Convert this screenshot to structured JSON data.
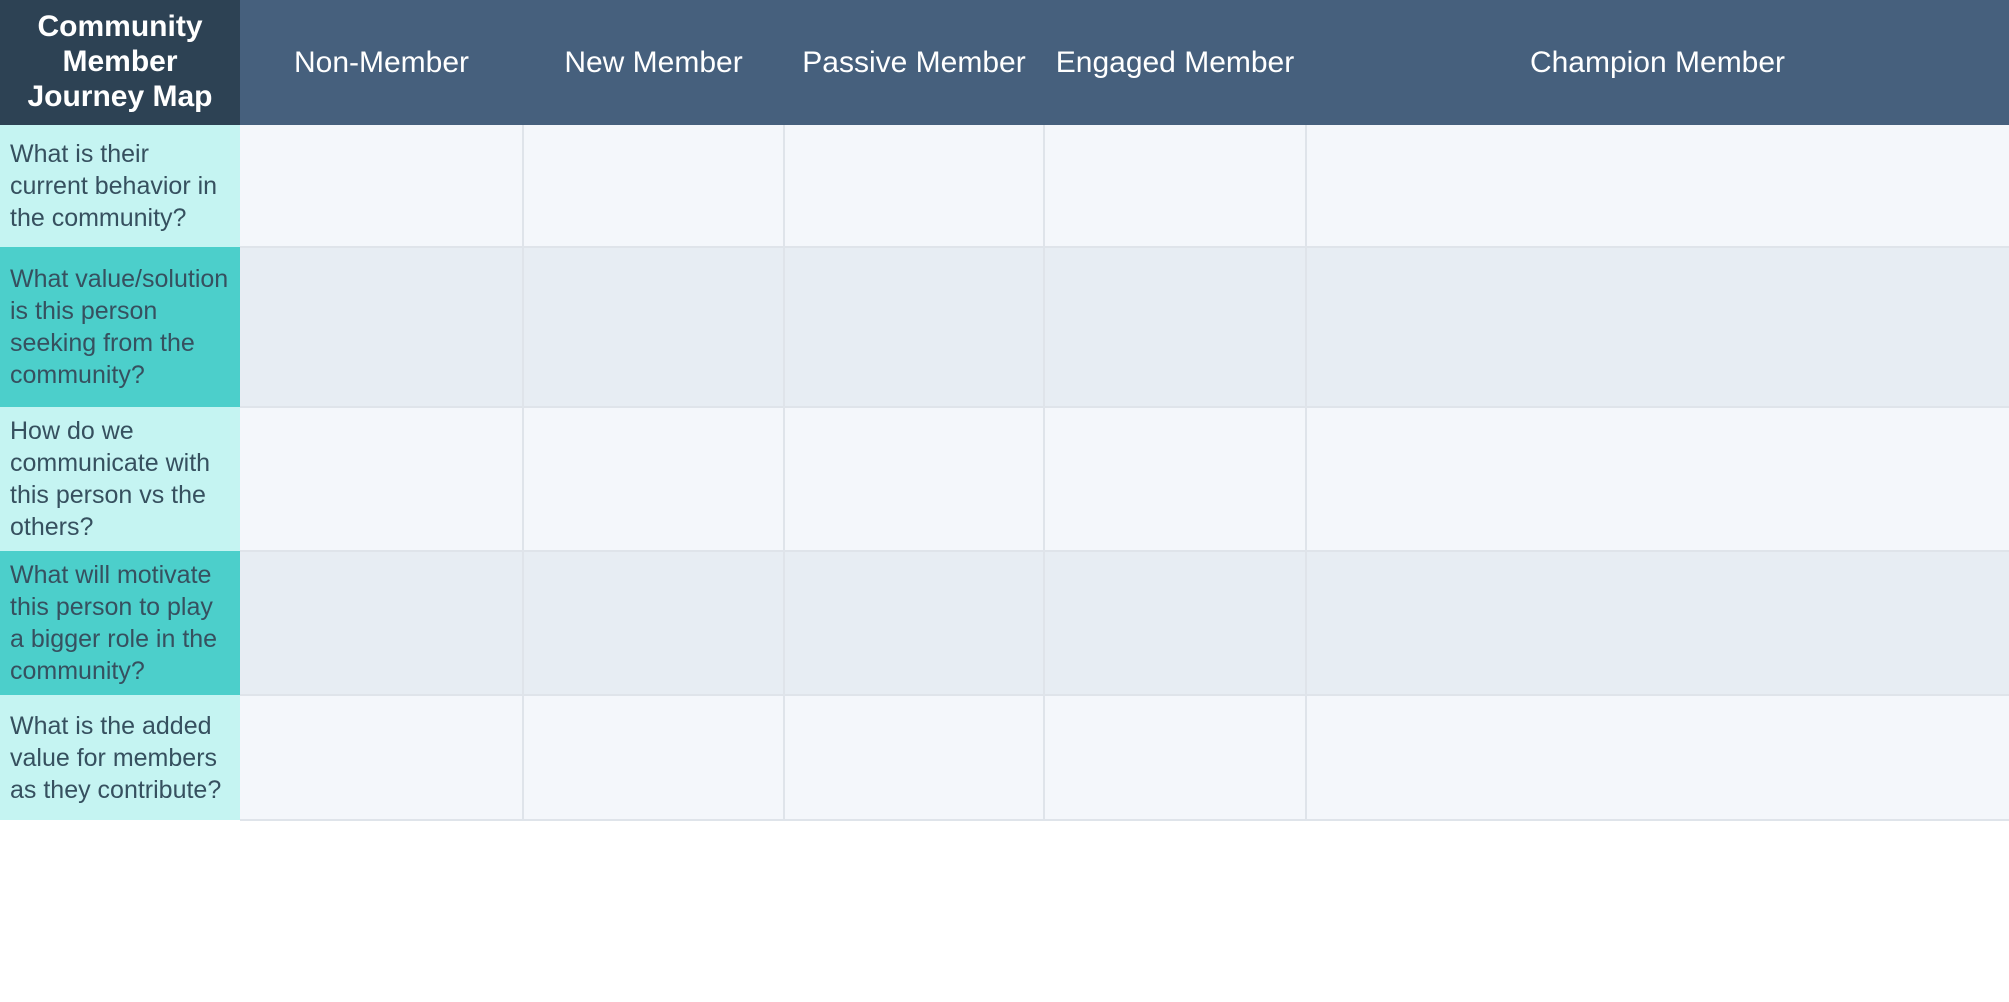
{
  "title": "Community Member Journey Map",
  "header": {
    "corner_label": "Community Member Journey Map",
    "stages": [
      {
        "label": "Non-Member"
      },
      {
        "label": "New Member"
      },
      {
        "label": "Passive Member"
      },
      {
        "label": "Engaged Member"
      },
      {
        "label": "Champion Member"
      }
    ]
  },
  "rows": [
    {
      "question": "What is their current behavior in the community?",
      "tone": "light"
    },
    {
      "question": "What value/solution is this person seeking from the community?",
      "tone": "dark"
    },
    {
      "question": "How do we communicate with this person vs the others?",
      "tone": "light"
    },
    {
      "question": "What will motivate this person to play a bigger role in the community?",
      "tone": "dark"
    },
    {
      "question": "What is the added value for members as they contribute?",
      "tone": "light"
    }
  ],
  "cells": [
    [
      "",
      "",
      "",
      "",
      ""
    ],
    [
      "",
      "",
      "",
      "",
      ""
    ],
    [
      "",
      "",
      "",
      "",
      ""
    ],
    [
      "",
      "",
      "",
      "",
      ""
    ],
    [
      "",
      "",
      "",
      "",
      ""
    ]
  ],
  "colors": {
    "corner_bg": "#2d4254",
    "header_bg": "#46607d",
    "header_text": "#ffffff",
    "question_light": "#c5f4f2",
    "question_dark": "#4ccfcb",
    "question_text": "#36505f",
    "cell_light": "#f4f7fb",
    "cell_dark": "#e7edf3",
    "grid_line": "#dfe4ea"
  }
}
